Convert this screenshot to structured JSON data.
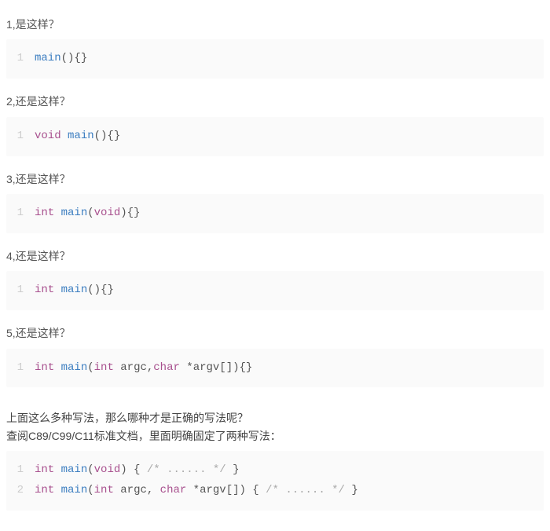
{
  "q1": {
    "label": "1,是这样？"
  },
  "q2": {
    "label": "2,还是这样？"
  },
  "q3": {
    "label": "3,还是这样？"
  },
  "q4": {
    "label": "4,还是这样？"
  },
  "q5": {
    "label": "5,还是这样？"
  },
  "code1": {
    "line1": {
      "num": "1",
      "t0": "main",
      "t1": "(){}"
    }
  },
  "code2": {
    "line1": {
      "num": "1",
      "t0": "void",
      "t1": " ",
      "t2": "main",
      "t3": "(){}"
    }
  },
  "code3": {
    "line1": {
      "num": "1",
      "t0": "int",
      "t1": " ",
      "t2": "main",
      "t3": "(",
      "t4": "void",
      "t5": "){}"
    }
  },
  "code4": {
    "line1": {
      "num": "1",
      "t0": "int",
      "t1": " ",
      "t2": "main",
      "t3": "(){}"
    }
  },
  "code5": {
    "line1": {
      "num": "1",
      "t0": "int",
      "t1": " ",
      "t2": "main",
      "t3": "(",
      "t4": "int",
      "t5": " argc,",
      "t6": "char",
      "t7": " *argv[]){}"
    }
  },
  "para": {
    "l1": "上面这么多种写法，那么哪种才是正确的写法呢？",
    "l2": "查阅C89/C99/C11标准文档，里面明确固定了两种写法："
  },
  "code6": {
    "line1": {
      "num": "1",
      "t0": "int",
      "t1": " ",
      "t2": "main",
      "t3": "(",
      "t4": "void",
      "t5": ") { ",
      "t6": "/* ...... */",
      "t7": " }"
    },
    "line2": {
      "num": "2",
      "t0": "int",
      "t1": " ",
      "t2": "main",
      "t3": "(",
      "t4": "int",
      "t5": " argc, ",
      "t6": "char",
      "t7": " *argv[]) { ",
      "t8": "/* ...... */",
      "t9": " }"
    }
  }
}
